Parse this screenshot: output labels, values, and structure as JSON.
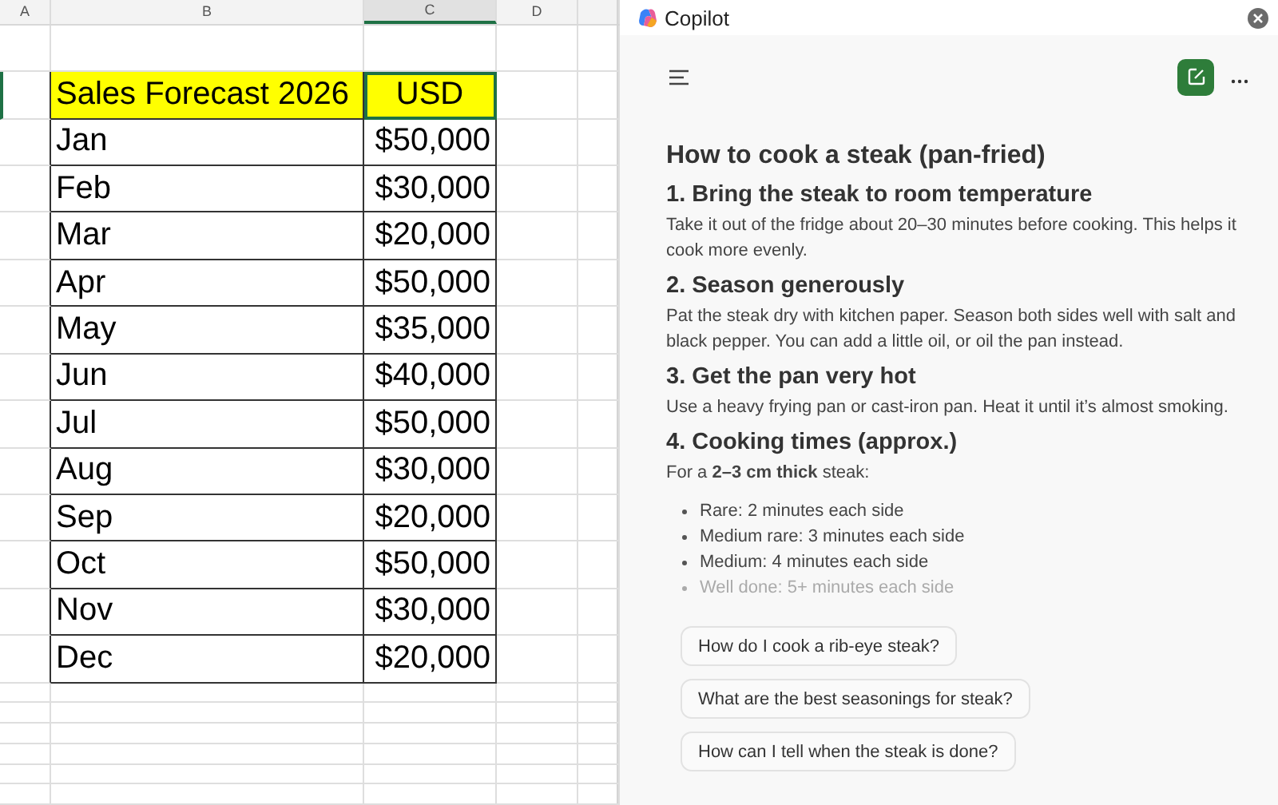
{
  "sheet": {
    "columns": [
      {
        "label": "A",
        "selected": false
      },
      {
        "label": "B",
        "selected": false
      },
      {
        "label": "C",
        "selected": true
      },
      {
        "label": "D",
        "selected": false
      }
    ],
    "header": [
      {
        "text": "Sales Forecast 2026",
        "selected": false
      },
      {
        "text": "USD",
        "selected": true
      }
    ],
    "rows": [
      {
        "month": "Jan",
        "amount": "$50,000"
      },
      {
        "month": "Feb",
        "amount": "$30,000"
      },
      {
        "month": "Mar",
        "amount": "$20,000"
      },
      {
        "month": "Apr",
        "amount": "$50,000"
      },
      {
        "month": "May",
        "amount": "$35,000"
      },
      {
        "month": "Jun",
        "amount": "$40,000"
      },
      {
        "month": "Jul",
        "amount": "$50,000"
      },
      {
        "month": "Aug",
        "amount": "$30,000"
      },
      {
        "month": "Sep",
        "amount": "$20,000"
      },
      {
        "month": "Oct",
        "amount": "$50,000"
      },
      {
        "month": "Nov",
        "amount": "$30,000"
      },
      {
        "month": "Dec",
        "amount": "$20,000"
      }
    ]
  },
  "copilot": {
    "title": "Copilot",
    "answer": {
      "title": "How to cook a steak (pan-fried)",
      "sections": [
        {
          "heading": "1. Bring the steak to room temperature",
          "text": "Take it out of the fridge about 20–30 minutes before cooking. This helps it cook more evenly."
        },
        {
          "heading": "2. Season generously",
          "text": "Pat the steak dry with kitchen paper. Season both sides well with salt and black pepper. You can add a little oil, or oil the pan instead."
        },
        {
          "heading": "3. Get the pan very hot",
          "text": "Use a heavy frying pan or cast-iron pan. Heat it until it’s almost smoking."
        },
        {
          "heading": "4. Cooking times (approx.)",
          "text": "For a **2–3 cm thick** steak:",
          "bullets": [
            {
              "text": "Rare: 2 minutes each side",
              "faded": false
            },
            {
              "text": "Medium rare: 3 minutes each side",
              "faded": false
            },
            {
              "text": "Medium: 4 minutes each side",
              "faded": false
            },
            {
              "text": "Well done: 5+ minutes each side",
              "faded": true
            }
          ]
        }
      ]
    },
    "suggestions": [
      "How do I cook a rib-eye steak?",
      "What are the best seasonings for steak?",
      "How can I tell when the steak is done?"
    ]
  }
}
